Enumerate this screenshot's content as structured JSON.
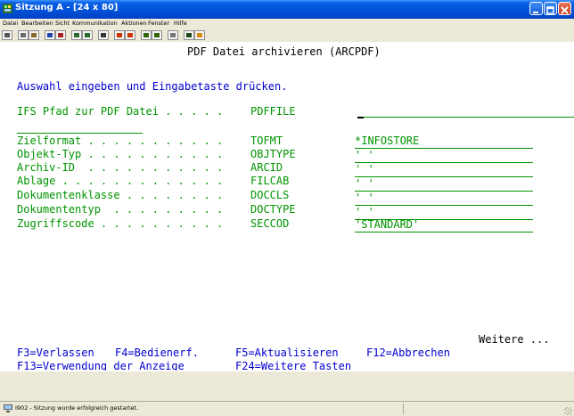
{
  "window": {
    "title": "Sitzung A - [24 x 80]"
  },
  "menu": [
    "Datei",
    "Bearbeiten",
    "Sicht",
    "Kommunikation",
    "Aktionen",
    "Fenster",
    "Hilfe"
  ],
  "toolbar_icons": [
    "print-icon",
    "copy-icon",
    "paste-icon",
    "send-icon",
    "receive-icon",
    "display-icon",
    "keypad-icon",
    "chart-icon",
    "macro-record-icon",
    "macro-stop-icon",
    "macro-play-icon",
    "macro-list-icon",
    "document-icon",
    "disk-icon",
    "edit-icon"
  ],
  "screen": {
    "title": "PDF Datei archivieren (ARCPDF)",
    "instruction": "Auswahl eingeben und Eingabetaste drücken.",
    "ifs_label": "IFS Pfad zur PDF Datei . . . . .",
    "ifs_keyword": "PDFFILE",
    "params": [
      {
        "label": "Zielformat . . . . . . . . . . .",
        "keyword": "TOFMT",
        "value": "*INFOSTORE"
      },
      {
        "label": "Objekt-Typ . . . . . . . . . . .",
        "keyword": "OBJTYPE",
        "value": "' '"
      },
      {
        "label": "Archiv-ID  . . . . . . . . . . .",
        "keyword": "ARCID",
        "value": "' '"
      },
      {
        "label": "Ablage . . . . . . . . . . . . .",
        "keyword": "FILCAB",
        "value": "' '"
      },
      {
        "label": "Dokumentenklasse . . . . . . . .",
        "keyword": "DOCCLS",
        "value": "' '"
      },
      {
        "label": "Dokumententyp  . . . . . . . . .",
        "keyword": "DOCTYPE",
        "value": "' '"
      },
      {
        "label": "Zugriffscode . . . . . . . . . .",
        "keyword": "SECCOD",
        "value": "'STANDARD'"
      }
    ],
    "more": "Weitere ...",
    "fkeys_row1": [
      "F3=Verlassen",
      "F4=Bedienerf.",
      "F5=Aktualisieren",
      "F12=Abbrechen"
    ],
    "fkeys_row2": [
      "F13=Verwendung der Anzeige",
      "F24=Weitere Tasten"
    ]
  },
  "status": {
    "message": "I902 - Sitzung wurde erfolgreich gestartet."
  },
  "colors": {
    "field_green": "#009400",
    "instruction_blue": "#0000d0",
    "title_blue": "#0050d8"
  }
}
